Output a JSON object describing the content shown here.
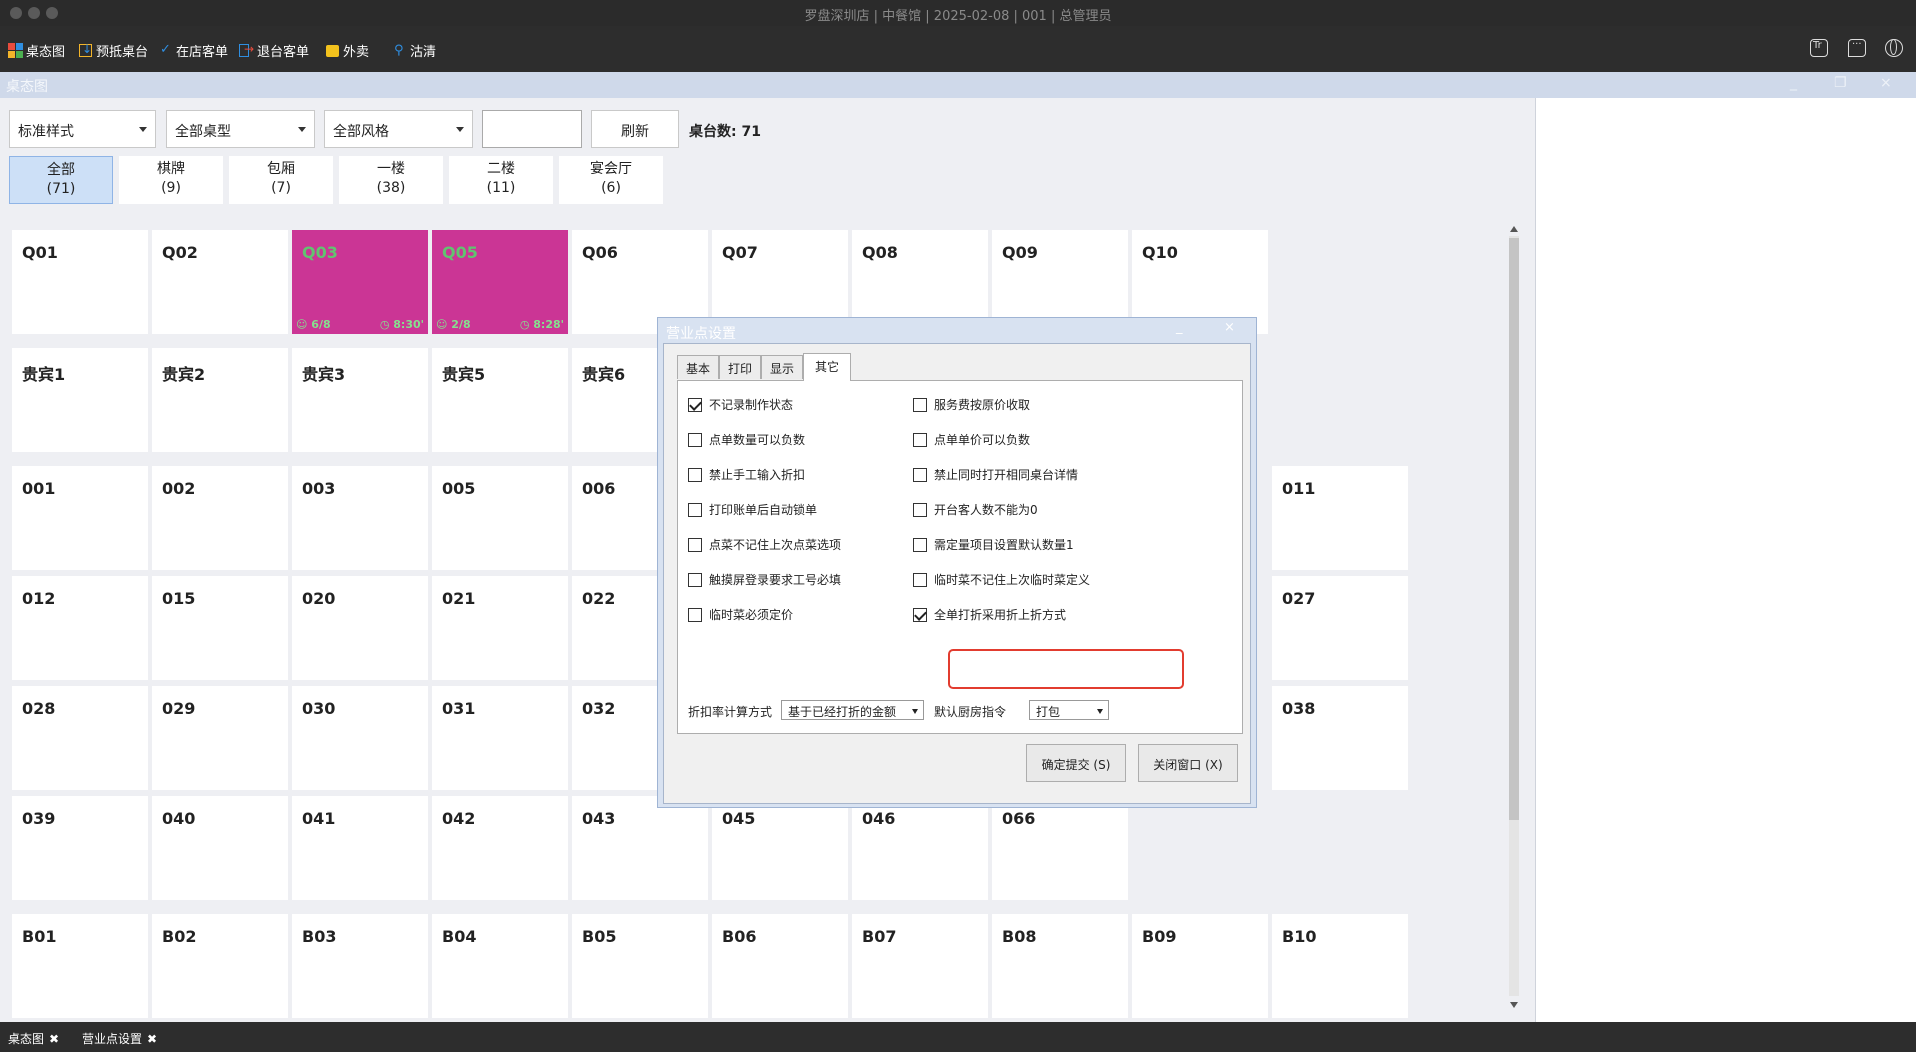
{
  "window": {
    "title": "罗盘深圳店 | 中餐馆 | 2025-02-08 | 001 | 总管理员"
  },
  "toolbar": {
    "items": [
      "桌态图",
      "预抵桌台",
      "在店客单",
      "退台客单",
      "外卖",
      "沽清"
    ],
    "right_icons": [
      "text-size-icon",
      "message-icon",
      "globe-icon"
    ]
  },
  "panel": {
    "title": "桌态图",
    "min": "_",
    "restore": "❐",
    "close": "×"
  },
  "filters": {
    "style": "标准样式",
    "type": "全部桌型",
    "theme": "全部风格",
    "search": "",
    "refresh": "刷新",
    "count_label": "桌台数:",
    "count_value": "71"
  },
  "areas": [
    {
      "name": "全部",
      "count": "(71)"
    },
    {
      "name": "棋牌",
      "count": "(9)"
    },
    {
      "name": "包厢",
      "count": "(7)"
    },
    {
      "name": "一楼",
      "count": "(38)"
    },
    {
      "name": "二楼",
      "count": "(11)"
    },
    {
      "name": "宴会厅",
      "count": "(6)"
    }
  ],
  "tables": [
    [
      "Q01",
      "Q02",
      "Q03",
      "Q05",
      "Q06",
      "Q07",
      "Q08",
      "Q09",
      "Q10"
    ],
    [
      "贵宾1",
      "贵宾2",
      "贵宾3",
      "贵宾5",
      "贵宾6"
    ],
    [
      "001",
      "002",
      "003",
      "005",
      "006",
      "011"
    ],
    [
      "012",
      "015",
      "020",
      "021",
      "022",
      "027"
    ],
    [
      "028",
      "029",
      "030",
      "031",
      "032",
      "038"
    ],
    [
      "039",
      "040",
      "041",
      "042",
      "043",
      "045",
      "046",
      "066"
    ],
    [
      "B01",
      "B02",
      "B03",
      "B04",
      "B05",
      "B06",
      "B07",
      "B08",
      "B09",
      "B10"
    ]
  ],
  "occupied": {
    "Q03": {
      "guests": "6/8",
      "time": "8:30'"
    },
    "Q05": {
      "guests": "2/8",
      "time": "8:28'"
    }
  },
  "dialog": {
    "title": "营业点设置",
    "min": "_",
    "close": "×",
    "tabs": [
      "基本",
      "打印",
      "显示",
      "其它"
    ],
    "options": [
      {
        "label": "不记录制作状态",
        "checked": true
      },
      {
        "label": "服务费按原价收取",
        "checked": false
      },
      {
        "label": "点单数量可以负数",
        "checked": false
      },
      {
        "label": "点单单价可以负数",
        "checked": false
      },
      {
        "label": "禁止手工输入折扣",
        "checked": false
      },
      {
        "label": "禁止同时打开相同桌台详情",
        "checked": false
      },
      {
        "label": "打印账单后自动锁单",
        "checked": false
      },
      {
        "label": "开台客人数不能为0",
        "checked": false
      },
      {
        "label": "点菜不记住上次点菜选项",
        "checked": false
      },
      {
        "label": "需定量项目设置默认数量1",
        "checked": false
      },
      {
        "label": "触摸屏登录要求工号必填",
        "checked": false
      },
      {
        "label": "临时菜不记住上次临时菜定义",
        "checked": false
      },
      {
        "label": "临时菜必须定价",
        "checked": false
      },
      {
        "label": "全单打折采用折上折方式",
        "checked": true
      }
    ],
    "discount_label": "折扣率计算方式",
    "discount_value": "基于已经打折的金额",
    "kitchen_label": "默认厨房指令",
    "kitchen_value": "打包",
    "submit": "确定提交 (S)",
    "close_btn": "关闭窗口 (X)"
  },
  "statusbar": {
    "tabs": [
      "桌态图",
      "营业点设置"
    ],
    "close": "✖"
  },
  "colors": {
    "occupied": "#cb3595",
    "occupied_text": "#62c370",
    "highlight": "#e23c2f"
  }
}
